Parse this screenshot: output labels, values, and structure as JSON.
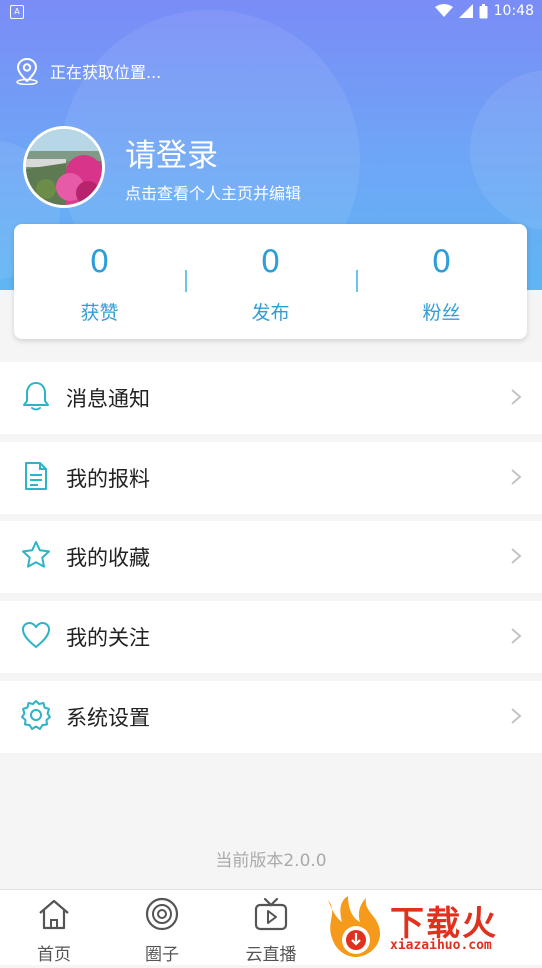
{
  "status_bar": {
    "time": "10:48"
  },
  "header": {
    "location_text": "正在获取位置...",
    "title": "请登录",
    "subtitle": "点击查看个人主页并编辑"
  },
  "stats": [
    {
      "value": "0",
      "label": "获赞"
    },
    {
      "value": "0",
      "label": "发布"
    },
    {
      "value": "0",
      "label": "粉丝"
    }
  ],
  "menu": [
    {
      "label": "消息通知",
      "icon": "bell-icon"
    },
    {
      "label": "我的报料",
      "icon": "document-icon"
    },
    {
      "label": "我的收藏",
      "icon": "star-icon"
    },
    {
      "label": "我的关注",
      "icon": "heart-icon"
    },
    {
      "label": "系统设置",
      "icon": "gear-icon"
    }
  ],
  "version_text": "当前版本2.0.0",
  "tabbar": [
    {
      "label": "首页",
      "icon": "home-icon"
    },
    {
      "label": "圈子",
      "icon": "circle-icon"
    },
    {
      "label": "云直播",
      "icon": "tv-play-icon"
    }
  ],
  "watermark": {
    "title": "下载火",
    "url": "xiazaihuo.com"
  },
  "colors": {
    "accent": "#2e9fd6",
    "header_top": "#7a8cf7",
    "header_bottom": "#5fb6f4",
    "watermark": "#e0301e"
  }
}
